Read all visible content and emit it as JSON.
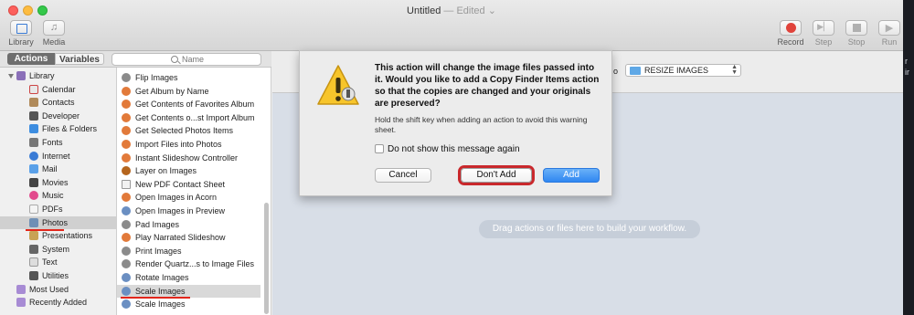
{
  "window": {
    "title": "Untitled",
    "edited_suffix": "— Edited ⌄"
  },
  "toolbar": {
    "library_label": "Library",
    "media_label": "Media",
    "record_label": "Record",
    "step_label": "Step",
    "stop_label": "Stop",
    "run_label": "Run"
  },
  "tabs": {
    "actions": "Actions",
    "variables": "Variables"
  },
  "search": {
    "placeholder": "Name"
  },
  "library": {
    "root_label": "Library",
    "items": [
      {
        "label": "Calendar",
        "icon": "calendar-icon",
        "color": "#e8e8e8"
      },
      {
        "label": "Contacts",
        "icon": "contacts-icon",
        "color": "#b08a5a"
      },
      {
        "label": "Developer",
        "icon": "developer-icon",
        "color": "#555555"
      },
      {
        "label": "Files & Folders",
        "icon": "finder-icon",
        "color": "#3d8de0"
      },
      {
        "label": "Fonts",
        "icon": "fonts-icon",
        "color": "#777777"
      },
      {
        "label": "Internet",
        "icon": "internet-icon",
        "color": "#3a7bd5"
      },
      {
        "label": "Mail",
        "icon": "mail-icon",
        "color": "#5aa0e8"
      },
      {
        "label": "Movies",
        "icon": "movies-icon",
        "color": "#444444"
      },
      {
        "label": "Music",
        "icon": "music-icon",
        "color": "#e24a8d"
      },
      {
        "label": "PDFs",
        "icon": "pdf-icon",
        "color": "#d0d0d0"
      },
      {
        "label": "Photos",
        "icon": "photos-icon",
        "color": "#6f8fb5"
      },
      {
        "label": "Presentations",
        "icon": "presentations-icon",
        "color": "#c8a254"
      },
      {
        "label": "System",
        "icon": "system-icon",
        "color": "#666666"
      },
      {
        "label": "Text",
        "icon": "text-icon",
        "color": "#999999"
      },
      {
        "label": "Utilities",
        "icon": "utilities-icon",
        "color": "#555555"
      }
    ],
    "most_used": "Most Used",
    "recently_added": "Recently Added"
  },
  "actions": {
    "items": [
      "Flip Images",
      "Get Album by Name",
      "Get Contents of Favorites Album",
      "Get Contents o...st Import Album",
      "Get Selected Photos Items",
      "Import Files into Photos",
      "Instant Slideshow Controller",
      "Layer on Images",
      "New PDF Contact Sheet",
      "Open Images in Acorn",
      "Open Images in Preview",
      "Pad Images",
      "Play Narrated Slideshow",
      "Print Images",
      "Render Quartz...s to Image Files",
      "Rotate Images",
      "Scale Images",
      "Scale Images"
    ]
  },
  "workflow": {
    "folder_label_suffix": "o",
    "folder_value": "RESIZE IMAGES",
    "hint": "Drag actions or files here to build your workflow."
  },
  "dialog": {
    "title": "This action will change the image files passed into it.  Would you like to add a Copy Finder Items action so that the copies are changed and your originals are preserved?",
    "subtitle": "Hold the shift key when adding an action to avoid this warning sheet.",
    "checkbox_label": "Do not show this message again",
    "cancel": "Cancel",
    "dont_add": "Don't Add",
    "add": "Add"
  },
  "colors": {
    "accent_blue": "#2f86f1",
    "highlight_red": "#c9282c",
    "annotation_red": "#e2271c"
  }
}
